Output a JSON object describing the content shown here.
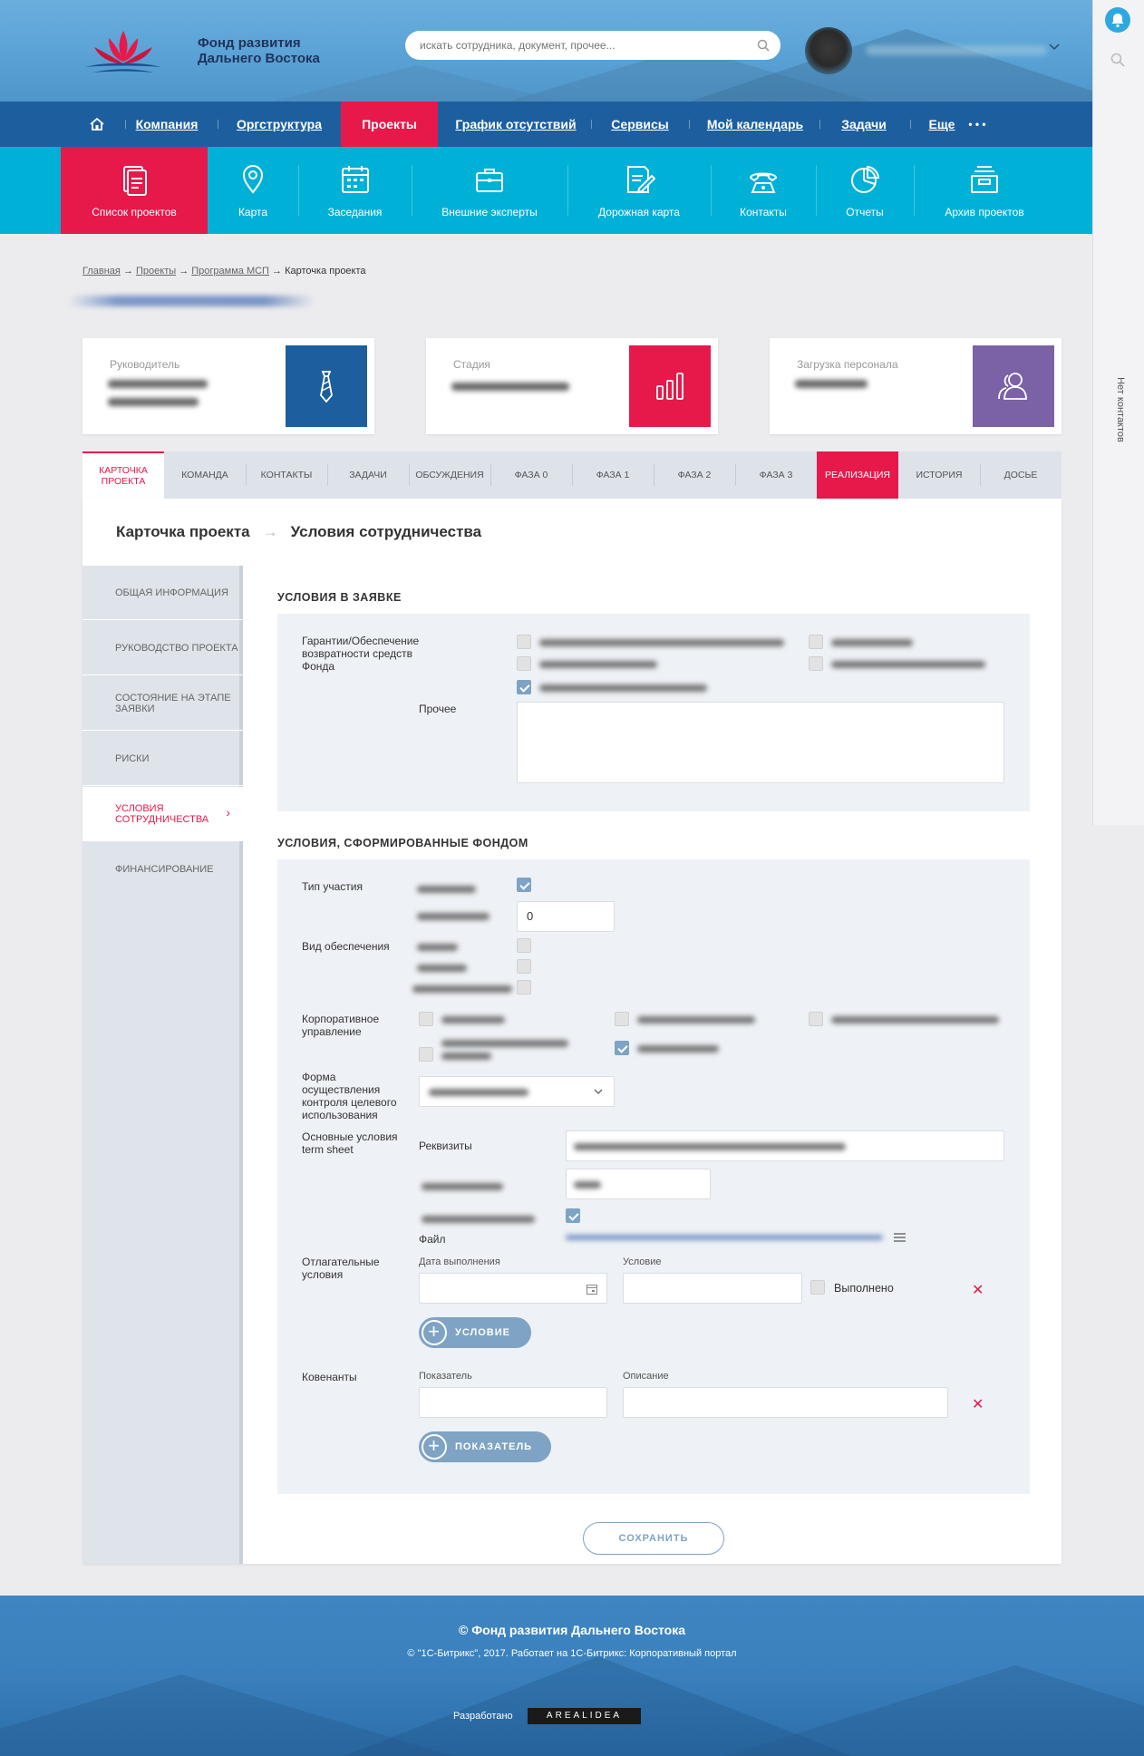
{
  "brand": {
    "name_line1": "Фонд развития",
    "name_line2": "Дальнего Востока",
    "accent": "#e7194a",
    "nav_blue": "#1d5f9e",
    "cyan": "#00b1d7"
  },
  "search": {
    "placeholder": "искать сотрудника, документ, прочее..."
  },
  "right_panel": {
    "no_contacts": "Нет контактов"
  },
  "nav": {
    "items": [
      "Компания",
      "Оргструктура",
      "Проекты",
      "График отсутствий",
      "Сервисы",
      "Мой календарь",
      "Задачи",
      "Еще"
    ],
    "active": "Проекты",
    "more_dots": "• • •"
  },
  "subnav": {
    "items": [
      "Список проектов",
      "Карта",
      "Заседания",
      "Внешние эксперты",
      "Дорожная карта",
      "Контакты",
      "Отчеты",
      "Архив проектов"
    ],
    "active": "Список проектов"
  },
  "breadcrumb": {
    "items": [
      "Главная",
      "Проекты",
      "Программа МСП"
    ],
    "current": "Карточка проекта",
    "sep": "→"
  },
  "cards": [
    {
      "label": "Руководитель",
      "color": "#1d5f9e",
      "icon": "tie-icon"
    },
    {
      "label": "Стадия",
      "color": "#e7194a",
      "icon": "bar-chart-icon"
    },
    {
      "label": "Загрузка персонала",
      "color": "#7b62a6",
      "icon": "people-icon"
    }
  ],
  "tabs": {
    "first_line1": "КАРТОЧКА",
    "first_line2": "ПРОЕКТА",
    "items": [
      "КОМАНДА",
      "КОНТАКТЫ",
      "ЗАДАЧИ",
      "ОБСУЖДЕНИЯ",
      "ФАЗА 0",
      "ФАЗА 1",
      "ФАЗА 2",
      "ФАЗА 3",
      "РЕАЛИЗАЦИЯ",
      "ИСТОРИЯ",
      "ДОСЬЕ"
    ],
    "active": "РЕАЛИЗАЦИЯ"
  },
  "heading": {
    "left": "Карточка проекта",
    "arrow": "→",
    "right": "Условия сотрудничества"
  },
  "sidebar": {
    "items": [
      "ОБЩАЯ ИНФОРМАЦИЯ",
      "РУКОВОДСТВО ПРОЕКТА",
      "СОСТОЯНИЕ НА ЭТАПЕ ЗАЯВКИ",
      "РИСКИ",
      "УСЛОВИЯ СОТРУДНИЧЕСТВА",
      "ФИНАНСИРОВАНИЕ"
    ],
    "active": "УСЛОВИЯ СОТРУДНИЧЕСТВА"
  },
  "section1": {
    "title": "УСЛОВИЯ В ЗАЯВКЕ",
    "guarantee_label": "Гарантии/Обеспечение возвратности средств Фонда",
    "other_label": "Прочее",
    "other_value": ""
  },
  "section2": {
    "title": "УСЛОВИЯ, СФОРМИРОВАННЫЕ ФОНДОМ",
    "participation_label": "Тип участия",
    "participation_value": "0",
    "security_label": "Вид обеспечения",
    "corp_label": "Корпоративное управление",
    "control_label": "Форма осуществления контроля целевого использования",
    "term_label": "Основные условия term sheet",
    "requisites_label": "Реквизиты",
    "file_label": "Файл",
    "deferred_label": "Отлагательные условия",
    "date_label": "Дата выполнения",
    "condition_label": "Условие",
    "done_label": "Выполнено",
    "add_condition": "УСЛОВИЕ",
    "covenants_label": "Ковенанты",
    "indicator_label": "Показатель",
    "description_label": "Описание",
    "add_indicator": "ПОКАЗАТЕЛЬ"
  },
  "save_label": "СОХРАНИТЬ",
  "footer": {
    "title": "© Фонд развития Дальнего Востока",
    "sub": "© \"1С-Битрикс\", 2017. Работает на 1С-Битрикс: Корпоративный портал",
    "dev_label": "Разработано",
    "dev_logo": "AREALIDEA"
  }
}
